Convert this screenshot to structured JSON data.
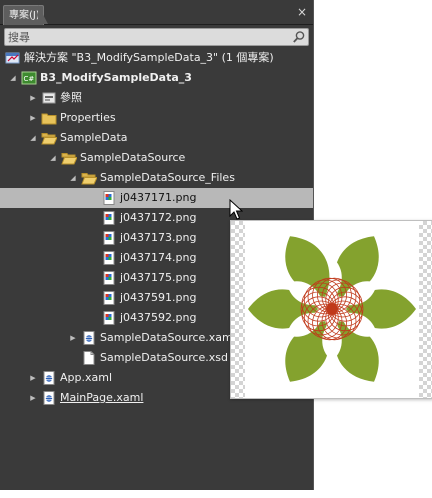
{
  "panel": {
    "tab_label": "專案(J)",
    "close_glyph": "×",
    "search": {
      "placeholder": "搜尋",
      "value": ""
    }
  },
  "tree": [
    {
      "label": "解決方案 \"B3_ModifySampleData_3\" (1 個專案)",
      "icon": "solution-icon",
      "expander": "",
      "depth": 0,
      "selected": false,
      "underline": false
    },
    {
      "label": "B3_ModifySampleData_3",
      "icon": "csharp-project-icon",
      "expander": "expanded",
      "depth": 0,
      "selected": false,
      "underline": false,
      "bold": true
    },
    {
      "label": "參照",
      "icon": "references-icon",
      "expander": "collapsed",
      "depth": 1,
      "selected": false,
      "underline": false
    },
    {
      "label": "Properties",
      "icon": "folder-icon",
      "expander": "collapsed",
      "depth": 1,
      "selected": false,
      "underline": false
    },
    {
      "label": "SampleData",
      "icon": "folder-open-icon",
      "expander": "expanded",
      "depth": 1,
      "selected": false,
      "underline": false
    },
    {
      "label": "SampleDataSource",
      "icon": "folder-open-icon",
      "expander": "expanded",
      "depth": 2,
      "selected": false,
      "underline": false
    },
    {
      "label": "SampleDataSource_Files",
      "icon": "folder-open-icon",
      "expander": "expanded",
      "depth": 3,
      "selected": false,
      "underline": false
    },
    {
      "label": "j0437171.png",
      "icon": "png-file-icon",
      "expander": "",
      "depth": 4,
      "selected": true,
      "underline": false
    },
    {
      "label": "j0437172.png",
      "icon": "png-file-icon",
      "expander": "",
      "depth": 4,
      "selected": false,
      "underline": false
    },
    {
      "label": "j0437173.png",
      "icon": "png-file-icon",
      "expander": "",
      "depth": 4,
      "selected": false,
      "underline": false
    },
    {
      "label": "j0437174.png",
      "icon": "png-file-icon",
      "expander": "",
      "depth": 4,
      "selected": false,
      "underline": false
    },
    {
      "label": "j0437175.png",
      "icon": "png-file-icon",
      "expander": "",
      "depth": 4,
      "selected": false,
      "underline": false
    },
    {
      "label": "j0437591.png",
      "icon": "png-file-icon",
      "expander": "",
      "depth": 4,
      "selected": false,
      "underline": false
    },
    {
      "label": "j0437592.png",
      "icon": "png-file-icon",
      "expander": "",
      "depth": 4,
      "selected": false,
      "underline": false
    },
    {
      "label": "SampleDataSource.xaml",
      "icon": "xaml-file-icon",
      "expander": "collapsed",
      "depth": 3,
      "selected": false,
      "underline": false
    },
    {
      "label": "SampleDataSource.xsd",
      "icon": "xsd-file-icon",
      "expander": "",
      "depth": 3,
      "selected": false,
      "underline": false
    },
    {
      "label": "App.xaml",
      "icon": "xaml-file-icon",
      "expander": "collapsed",
      "depth": 1,
      "selected": false,
      "underline": false
    },
    {
      "label": "MainPage.xaml",
      "icon": "xaml-file-icon",
      "expander": "collapsed",
      "depth": 1,
      "selected": false,
      "underline": true
    }
  ],
  "preview": {
    "image": "lotus-flower-clipart",
    "colors": {
      "leaf": "#7a9a1c",
      "center": "#c0391a"
    }
  },
  "colors": {
    "panel_bg": "#3a3a3a",
    "selection": "#b8b8b8",
    "text": "#f0f0f0"
  }
}
